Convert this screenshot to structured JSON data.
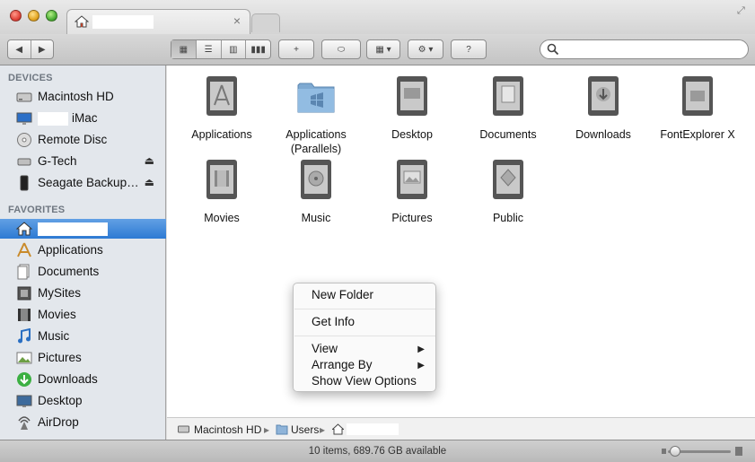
{
  "window": {
    "tab": {
      "title": "",
      "close": "×"
    }
  },
  "toolbar": {
    "back": "◀",
    "forward": "▶",
    "view_icon": "▦",
    "view_list": "☰",
    "view_columns": "▥",
    "view_coverflow": "▮▮▮",
    "new_folder": "+",
    "tag": "⬭",
    "arrange": "▦ ▾",
    "action": "⚙ ▾",
    "quicklook": "?",
    "search_placeholder": ""
  },
  "sidebar": {
    "devices_heading": "DEVICES",
    "devices": [
      {
        "label": "Macintosh HD",
        "icon": "hard-drive-icon"
      },
      {
        "label": "iMac",
        "icon": "imac-icon"
      },
      {
        "label": "Remote Disc",
        "icon": "disc-icon"
      },
      {
        "label": "G-Tech",
        "icon": "external-drive-icon",
        "eject": "⏏"
      },
      {
        "label": "Seagate Backup…",
        "icon": "external-drive-icon",
        "eject": "⏏"
      }
    ],
    "favorites_heading": "FAVORITES",
    "favorites": [
      {
        "label": "",
        "icon": "home-icon"
      },
      {
        "label": "Applications",
        "icon": "applications-icon"
      },
      {
        "label": "Documents",
        "icon": "documents-icon"
      },
      {
        "label": "MySites",
        "icon": "mysites-icon"
      },
      {
        "label": "Movies",
        "icon": "movies-icon"
      },
      {
        "label": "Music",
        "icon": "music-icon"
      },
      {
        "label": "Pictures",
        "icon": "pictures-icon"
      },
      {
        "label": "Downloads",
        "icon": "downloads-icon"
      },
      {
        "label": "Desktop",
        "icon": "desktop-icon"
      },
      {
        "label": "AirDrop",
        "icon": "airdrop-icon"
      }
    ]
  },
  "content": {
    "items": [
      {
        "label": "Applications",
        "icon": "applications-folder-icon"
      },
      {
        "label": "Applications (Parallels)",
        "icon": "blue-folder-icon"
      },
      {
        "label": "Desktop",
        "icon": "desktop-folder-icon"
      },
      {
        "label": "Documents",
        "icon": "documents-folder-icon"
      },
      {
        "label": "Downloads",
        "icon": "downloads-folder-icon"
      },
      {
        "label": "FontExplorer X",
        "icon": "fontexplorer-folder-icon"
      },
      {
        "label": "Movies",
        "icon": "movies-folder-icon"
      },
      {
        "label": "Music",
        "icon": "music-folder-icon"
      },
      {
        "label": "Pictures",
        "icon": "pictures-folder-icon"
      },
      {
        "label": "Public",
        "icon": "public-folder-icon"
      }
    ]
  },
  "context_menu": {
    "new_folder": "New Folder",
    "get_info": "Get Info",
    "view": "View",
    "arrange_by": "Arrange By",
    "show_view_options": "Show View Options",
    "submenu_arrow": "▶"
  },
  "pathbar": {
    "root": "Macintosh HD",
    "sep": "▸",
    "users": "Users",
    "home": ""
  },
  "status": {
    "text": "10 items, 689.76 GB available"
  },
  "colors": {
    "selection": "#3b86d9",
    "sidebar_bg": "#e3e7ec"
  }
}
